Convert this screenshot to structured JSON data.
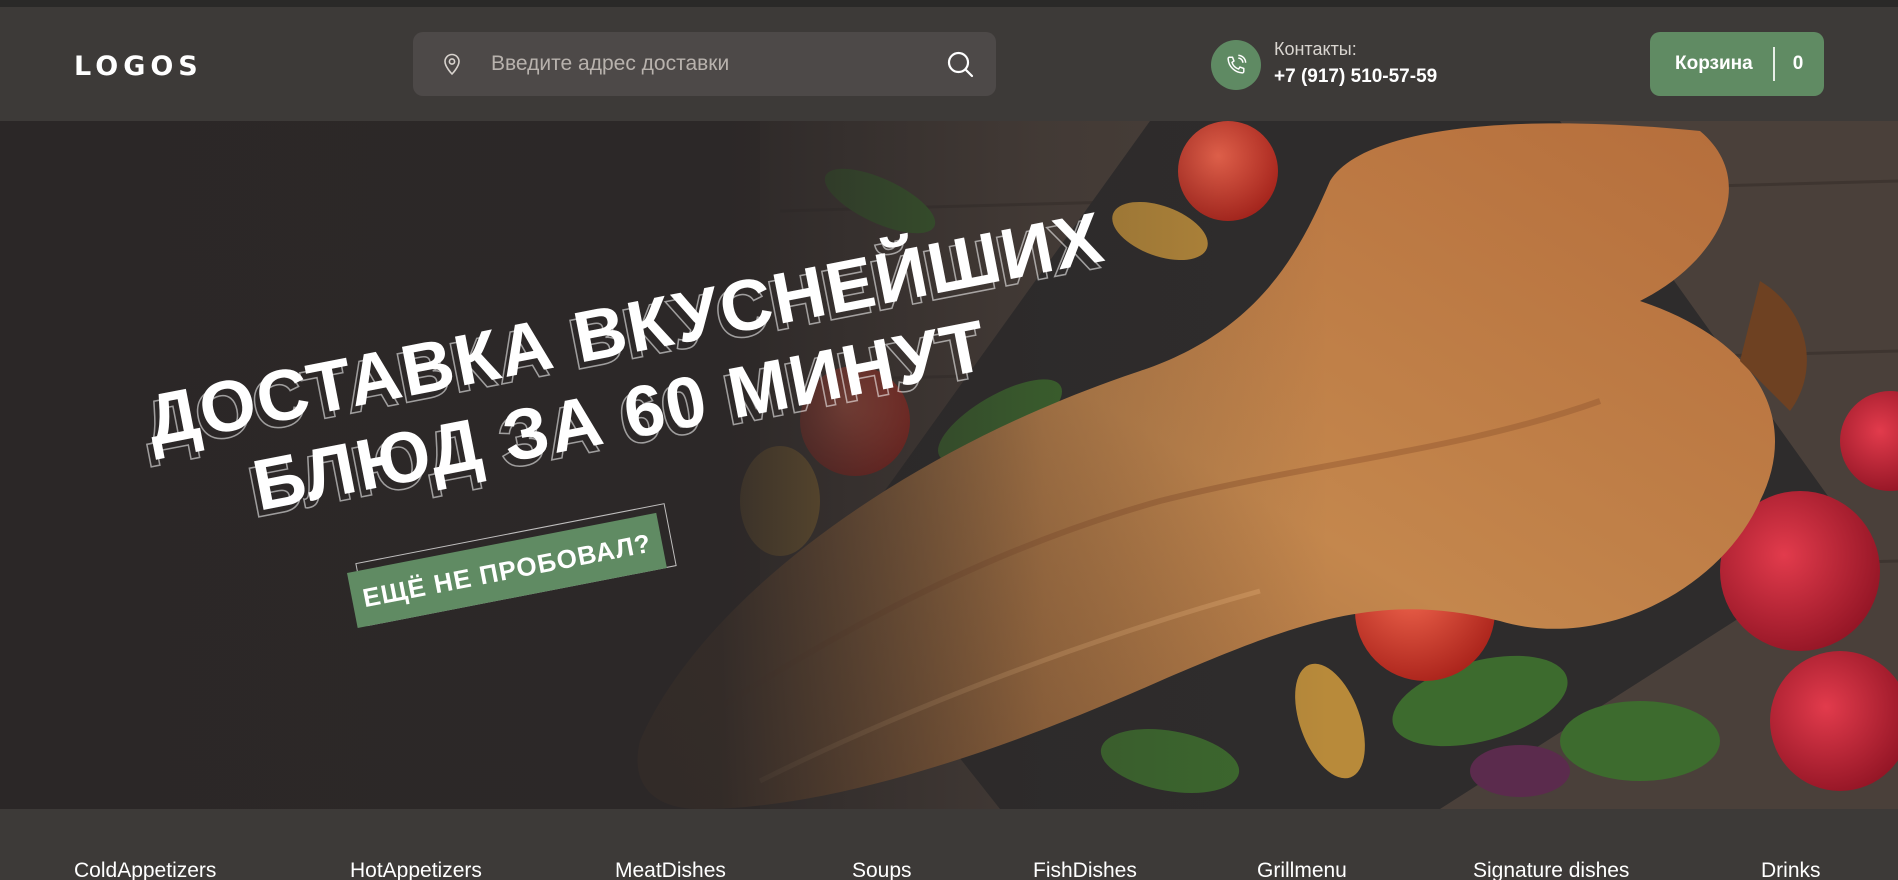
{
  "header": {
    "logo": "LOGOS",
    "search": {
      "placeholder": "Введите адрес доставки"
    },
    "contacts_label": "Контакты:",
    "contacts_phone": "+7 (917) 510-57-59",
    "cart_label": "Корзина",
    "cart_count": "0"
  },
  "hero": {
    "headline_line1": "ДОСТАВКА ВКУСНЕЙШИХ",
    "headline_line2": "БЛЮД ЗА 60 МИНУТ",
    "promo_label": "ЕЩЁ НЕ ПРОБОВАЛ?"
  },
  "categories": [
    "ColdAppetizers",
    "HotAppetizers",
    "MeatDishes",
    "Soups",
    "FishDishes",
    "Grillmenu",
    "Signature dishes",
    "Drinks"
  ],
  "colors": {
    "accent_green": "#608b63",
    "header_bg": "#3d3a38",
    "search_bg": "#4d4948"
  },
  "icons": [
    "location-pin-icon",
    "search-icon",
    "phone-icon"
  ]
}
